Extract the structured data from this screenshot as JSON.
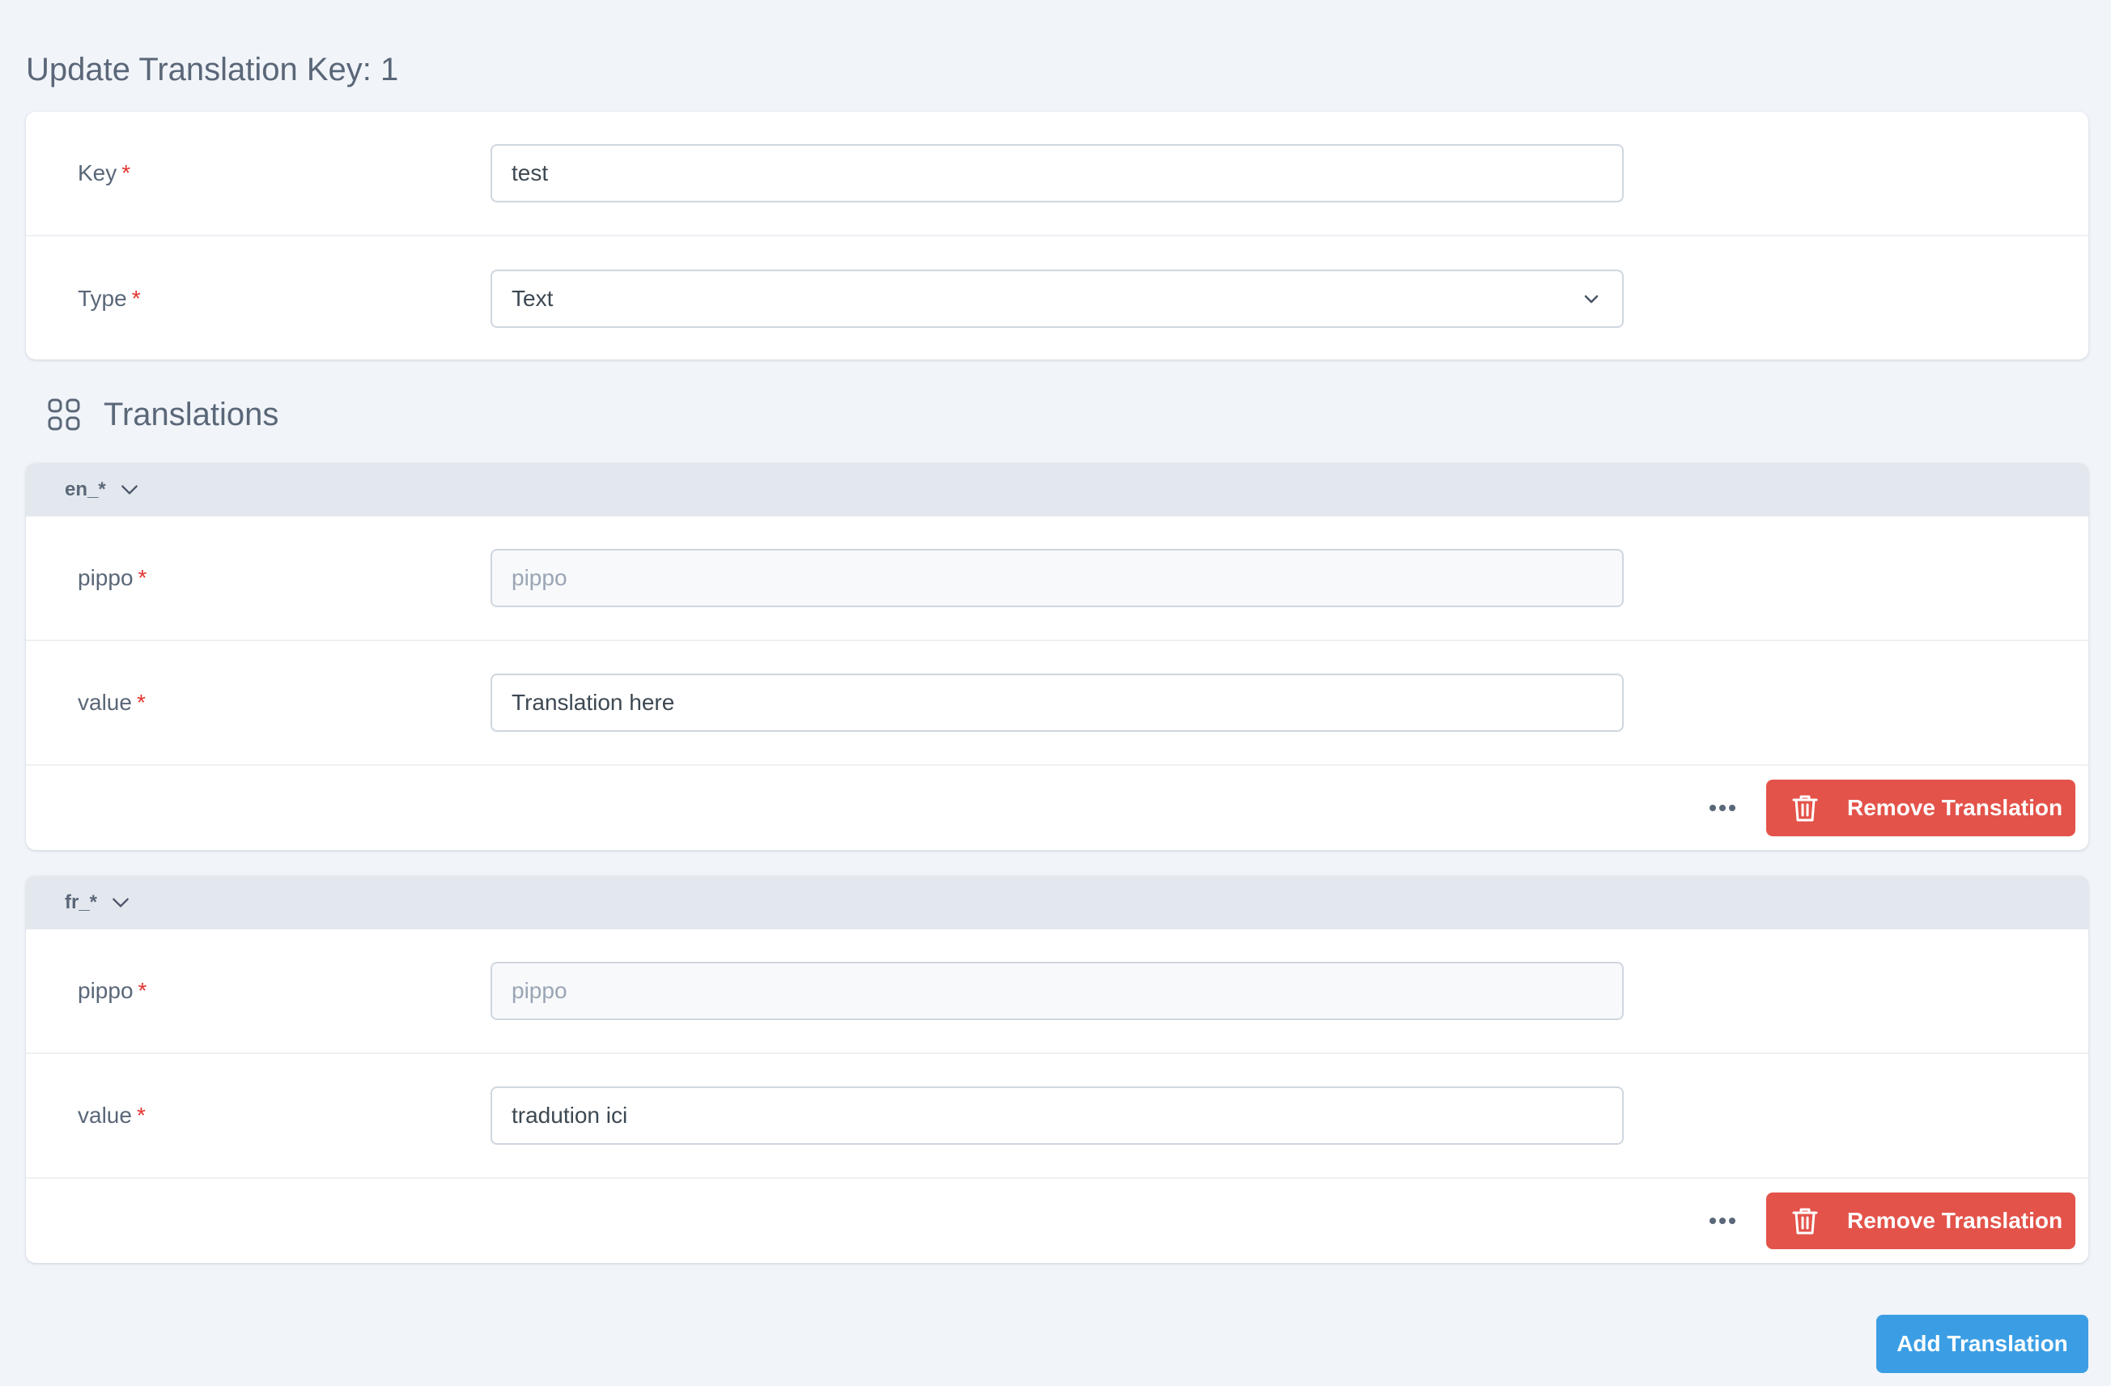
{
  "page": {
    "title": "Update Translation Key: 1"
  },
  "main_form": {
    "key_label": "Key",
    "key_value": "test",
    "type_label": "Type",
    "type_value": "Text",
    "required_mark": "*"
  },
  "translations": {
    "title": "Translations",
    "groups": [
      {
        "locale": "en_*",
        "pippo_label": "pippo",
        "pippo_placeholder": "pippo",
        "value_label": "value",
        "value_value": "Translation here",
        "remove_label": "Remove Translation"
      },
      {
        "locale": "fr_*",
        "pippo_label": "pippo",
        "pippo_placeholder": "pippo",
        "value_label": "value",
        "value_value": "tradution ici",
        "remove_label": "Remove Translation"
      }
    ],
    "add_label": "Add Translation"
  },
  "icons": {
    "section": "grid-icon",
    "collapse": "chevron-down-icon",
    "more": "more-horizontal-icon",
    "delete": "trash-icon"
  },
  "colors": {
    "required": "#e3342f",
    "danger": "#e3534a",
    "primary": "#3b9ee4",
    "background": "#f1f4f9"
  }
}
